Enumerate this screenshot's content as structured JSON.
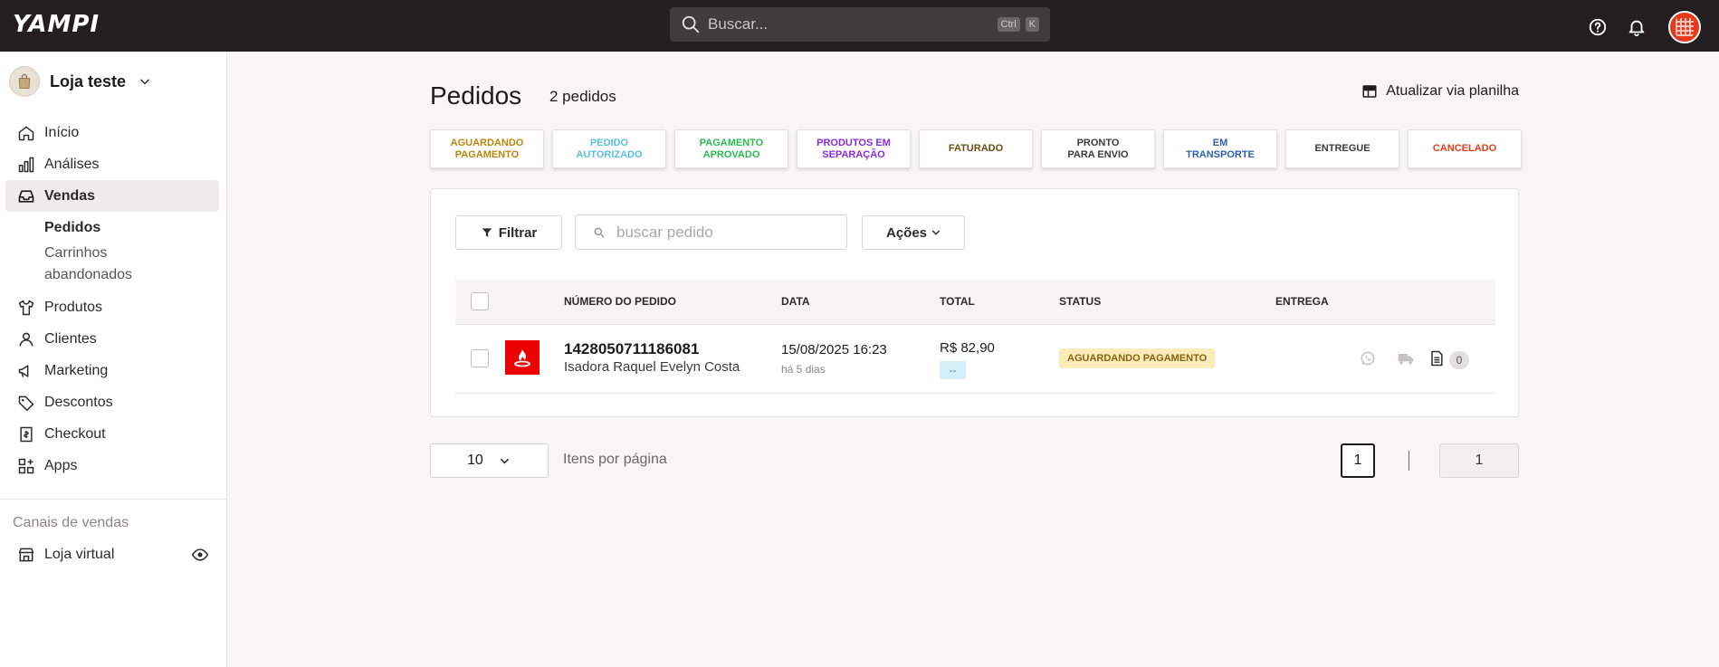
{
  "app": {
    "logo": "YAMPI"
  },
  "topbar": {
    "search_placeholder": "Buscar...",
    "shortcut_ctrl": "Ctrl",
    "shortcut_key": "K"
  },
  "sidebar": {
    "store_name": "Loja teste",
    "items": [
      {
        "label": "Início",
        "icon": "home-icon"
      },
      {
        "label": "Análises",
        "icon": "bar-chart-icon"
      },
      {
        "label": "Vendas",
        "icon": "inbox-icon",
        "active": true
      },
      {
        "label": "Produtos",
        "icon": "shirt-icon"
      },
      {
        "label": "Clientes",
        "icon": "user-icon"
      },
      {
        "label": "Marketing",
        "icon": "megaphone-icon"
      },
      {
        "label": "Descontos",
        "icon": "tag-icon"
      },
      {
        "label": "Checkout",
        "icon": "receipt-icon"
      },
      {
        "label": "Apps",
        "icon": "apps-icon"
      }
    ],
    "sub_items": [
      {
        "label": "Pedidos"
      },
      {
        "label": "Carrinhos abandonados"
      }
    ],
    "channels_label": "Canais de vendas",
    "loja_virtual": "Loja virtual"
  },
  "main": {
    "title": "Pedidos",
    "count": "2 pedidos",
    "sheet_button": "Atualizar via planilha",
    "status_tabs": [
      {
        "label": "AGUARDANDO PAGAMENTO",
        "color": "#b8860b"
      },
      {
        "label": "PEDIDO AUTORIZADO",
        "color": "#5bc0de"
      },
      {
        "label": "PAGAMENTO APROVADO",
        "color": "#2bbb4f"
      },
      {
        "label": "PRODUTOS EM SEPARAÇÃO",
        "color": "#8a2be2"
      },
      {
        "label": "FATURADO",
        "color": "#6b4c12"
      },
      {
        "label": "PRONTO PARA ENVIO",
        "color": "#3b3b3b"
      },
      {
        "label": "EM TRANSPORTE",
        "color": "#2e5fa8"
      },
      {
        "label": "ENTREGUE",
        "color": "#3b3b3b"
      },
      {
        "label": "CANCELADO",
        "color": "#ec3b1d"
      }
    ],
    "filter_button": "Filtrar",
    "search_placeholder": "buscar pedido",
    "actions_button": "Ações",
    "table": {
      "headers": [
        "NÚMERO DO PEDIDO",
        "DATA",
        "TOTAL",
        "STATUS",
        "ENTREGA"
      ],
      "rows": [
        {
          "order_number": "1428050711186081",
          "customer": "Isadora Raquel Evelyn Costa",
          "date": "15/08/2025 16:23",
          "ago": "há 5 dias",
          "total": "R$ 82,90",
          "payment_badge": "--",
          "status": "AGUARDANDO PAGAMENTO",
          "doc_count": "0"
        }
      ]
    },
    "pagination": {
      "per_page": "10",
      "per_page_label": "Itens por página",
      "current_page": "1",
      "last_page": "1"
    }
  }
}
